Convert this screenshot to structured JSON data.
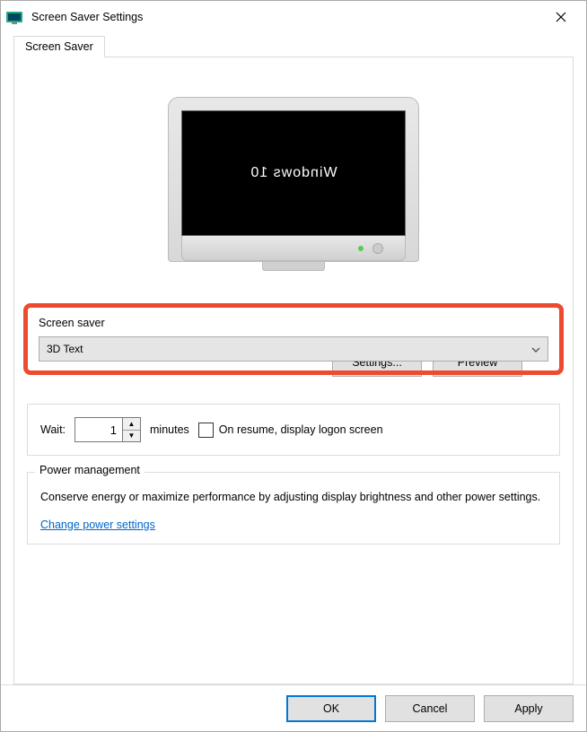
{
  "window": {
    "title": "Screen Saver Settings"
  },
  "tab": {
    "label": "Screen Saver"
  },
  "preview": {
    "text": "Windows 10"
  },
  "screenSaver": {
    "legend": "Screen saver",
    "selected": "3D Text",
    "settingsButton": "Settings...",
    "previewButton": "Preview"
  },
  "wait": {
    "label": "Wait:",
    "value": "1",
    "unit": "minutes",
    "resumeLabel": "On resume, display logon screen"
  },
  "power": {
    "legend": "Power management",
    "description": "Conserve energy or maximize performance by adjusting display brightness and other power settings.",
    "link": "Change power settings"
  },
  "footer": {
    "ok": "OK",
    "cancel": "Cancel",
    "apply": "Apply"
  }
}
